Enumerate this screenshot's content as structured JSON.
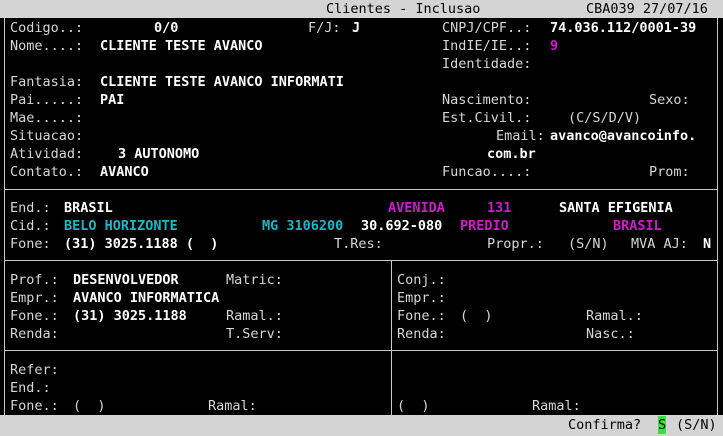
{
  "header": {
    "title": "Clientes - Inclusao",
    "code_date": "CBA039 27/07/16"
  },
  "labels": {
    "codigo": "Codigo..:",
    "fj": "F/J:",
    "cnpj": "CNPJ/CPF..:",
    "nome": "Nome....:",
    "indie": "IndIE/IE..:",
    "identidade": "Identidade:",
    "fantasia": "Fantasia:",
    "pai": "Pai.....:",
    "nascimento": "Nascimento:",
    "sexo": "Sexo:",
    "mae": "Mae.....:",
    "estcivil": "Est.Civil.:",
    "estcivil_opts": "(C/S/D/V)",
    "situacao": "Situacao:",
    "email": "Email:",
    "atividade": "Atividad:",
    "contato": "Contato.:",
    "funcao": "Funcao....:",
    "prom": "Prom:",
    "end": "End.:",
    "cid": "Cid.:",
    "fone": "Fone:",
    "tres": "T.Res:",
    "propr": "Propr.:",
    "sn": "(S/N)",
    "mva": "MVA AJ:",
    "prof": "Prof.:",
    "matric": "Matric:",
    "empr": "Empr.:",
    "fone2": "Fone.:",
    "ramal": "Ramal.:",
    "renda": "Renda:",
    "tserv": "T.Serv:",
    "conj": "Conj.:",
    "conj_empr": "Empr.:",
    "conj_fone": "Fone.:",
    "conj_fone_val": "(  )",
    "conj_ramal": "Ramal.:",
    "conj_renda": "Renda:",
    "nasc": "Nasc.:",
    "refer": "Refer:",
    "ref_end": "End.:",
    "ref_fone": "Fone.:",
    "ref_fone_val": "(  )",
    "ref_ramal": "Ramal:",
    "ref2_fone_val": "(  )",
    "ref2_ramal": "Ramal:"
  },
  "values": {
    "codigo": "0/0",
    "fj": "J",
    "cnpj": "74.036.112/0001-39",
    "nome": "CLIENTE TESTE AVANCO",
    "indie": "9",
    "fantasia": "CLIENTE TESTE AVANCO INFORMATI",
    "pai": "PAI",
    "email_line1": "avanco@avancoinfo.",
    "email_line2": "com.br",
    "atividade": "3 AUTONOMO",
    "contato": "AVANCO",
    "end": "BRASIL",
    "end_tipo": "AVENIDA",
    "end_num": "131",
    "bairro": "SANTA EFIGENIA",
    "cid": "BELO HORIZONTE",
    "uf_ibge": "MG 3106200",
    "cep": "30.692-080",
    "complemento": "PREDIO",
    "pais": "BRASIL",
    "fone": "(31) 3025.1188 (  )",
    "mva": "N",
    "prof": "DESENVOLVEDOR",
    "empr": "AVANCO INFORMATICA",
    "fone2": "(31) 3025.1188"
  },
  "footer": {
    "prompt": "Confirma?",
    "answer": "S",
    "options": "(S/N)"
  }
}
